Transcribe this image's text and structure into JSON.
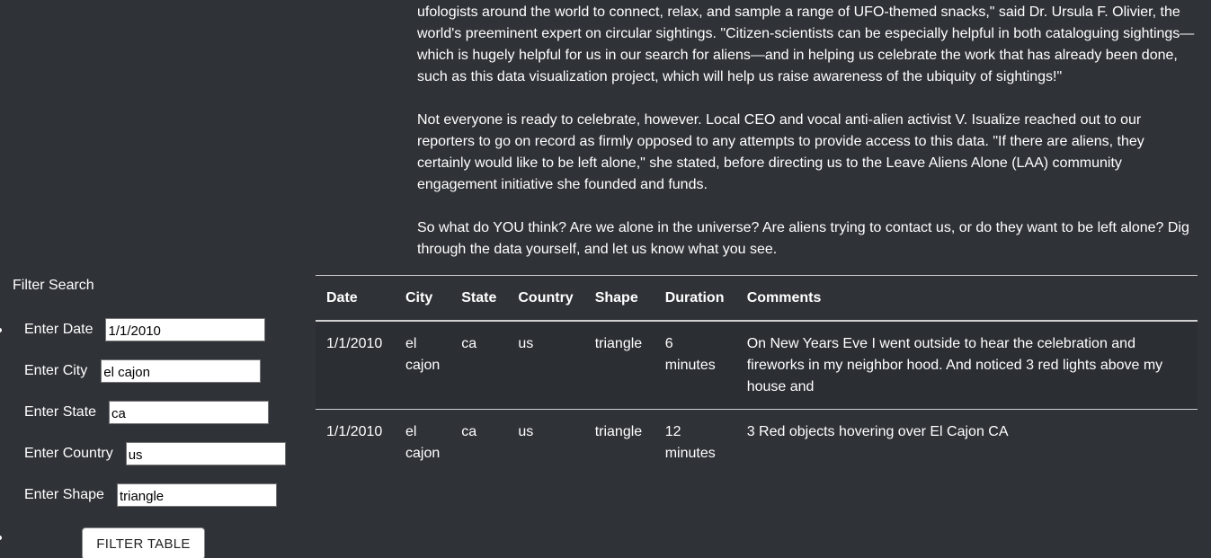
{
  "article": {
    "paragraphs": [
      "ufologists around the world to connect, relax, and sample a range of UFO-themed snacks,\" said Dr. Ursula F. Olivier, the world's preeminent expert on circular sightings. \"Citizen-scientists can be especially helpful in both cataloguing sightings—which is hugely helpful for us in our search for aliens—and in helping us celebrate the work that has already been done, such as this data visualization project, which will help us raise awareness of the ubiquity of sightings!\"",
      "Not everyone is ready to celebrate, however. Local CEO and vocal anti-alien activist V. Isualize reached out to our reporters to go on record as firmly opposed to any attempts to provide access to this data. \"If there are aliens, they certainly would like to be left alone,\" she stated, before directing us to the Leave Aliens Alone (LAA) community engagement initiative she founded and funds.",
      "So what do YOU think? Are we alone in the universe? Are aliens trying to contact us, or do they want to be left alone? Dig through the data yourself, and let us know what you see."
    ]
  },
  "filter": {
    "title": "Filter Search",
    "date": {
      "label": "Enter Date",
      "value": "1/1/2010"
    },
    "city": {
      "label": "Enter City",
      "value": "el cajon"
    },
    "state": {
      "label": "Enter State",
      "value": "ca"
    },
    "country": {
      "label": "Enter Country",
      "value": "us"
    },
    "shape": {
      "label": "Enter Shape",
      "value": "triangle"
    },
    "button_label": "FILTER TABLE"
  },
  "table": {
    "headers": [
      "Date",
      "City",
      "State",
      "Country",
      "Shape",
      "Duration",
      "Comments"
    ],
    "rows": [
      [
        "1/1/2010",
        "el cajon",
        "ca",
        "us",
        "triangle",
        "6 minutes",
        "On New Years Eve I went outside to hear the celebration and fireworks in my neighbor hood. And noticed 3 red lights above my house and"
      ],
      [
        "1/1/2010",
        "el cajon",
        "ca",
        "us",
        "triangle",
        "12 minutes",
        "3 Red objects hovering over El Cajon CA"
      ]
    ]
  }
}
